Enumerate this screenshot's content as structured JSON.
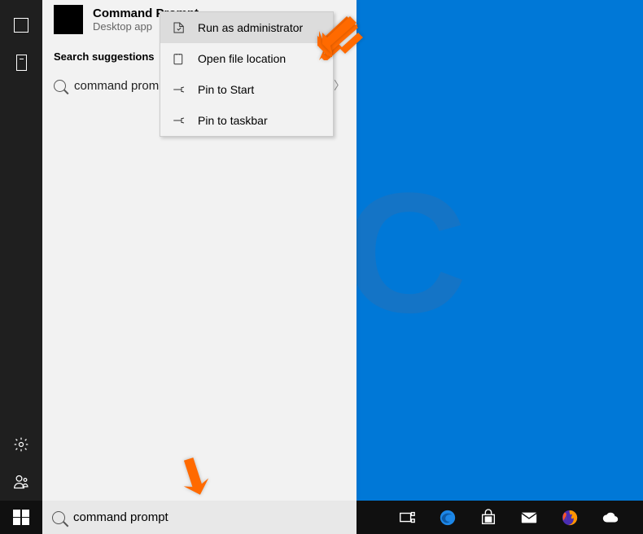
{
  "best_match": {
    "title": "Command Prompt",
    "subtitle": "Desktop app"
  },
  "suggestions_header": "Search suggestions",
  "suggestions": [
    {
      "text": "command prompt"
    }
  ],
  "context_menu": [
    {
      "label": "Run as administrator",
      "icon": "shield-icon",
      "highlight": true
    },
    {
      "label": "Open file location",
      "icon": "folder-icon",
      "highlight": false
    },
    {
      "label": "Pin to Start",
      "icon": "pin-icon",
      "highlight": false
    },
    {
      "label": "Pin to taskbar",
      "icon": "pin-icon",
      "highlight": false
    }
  ],
  "taskbar": {
    "search_value": "command prompt",
    "tray_icons": [
      "taskview-icon",
      "edge-icon",
      "store-icon",
      "mail-icon",
      "firefox-icon",
      "onedrive-icon"
    ]
  }
}
